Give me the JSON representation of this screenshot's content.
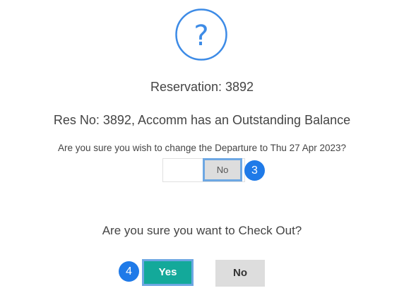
{
  "dialog": {
    "icon": "question-mark-icon",
    "reservation_title": "Reservation: 3892",
    "outstanding_balance_message": "Res No: 3892, Accomm has an Outstanding Balance",
    "departure_question": "Are you sure you wish to change the Departure to Thu 27 Apr 2023?",
    "departure_no_label": "No",
    "checkout_question": "Are you sure you want to Check Out?",
    "yes_label": "Yes",
    "checkout_no_label": "No"
  },
  "annotations": {
    "step_3": "3",
    "step_4": "4"
  },
  "colors": {
    "icon_blue": "#3d8be6",
    "highlight_border": "#6da7e3",
    "badge_blue": "#1f7ae8",
    "yes_green": "#13a99a",
    "button_gray": "#dddddd"
  }
}
